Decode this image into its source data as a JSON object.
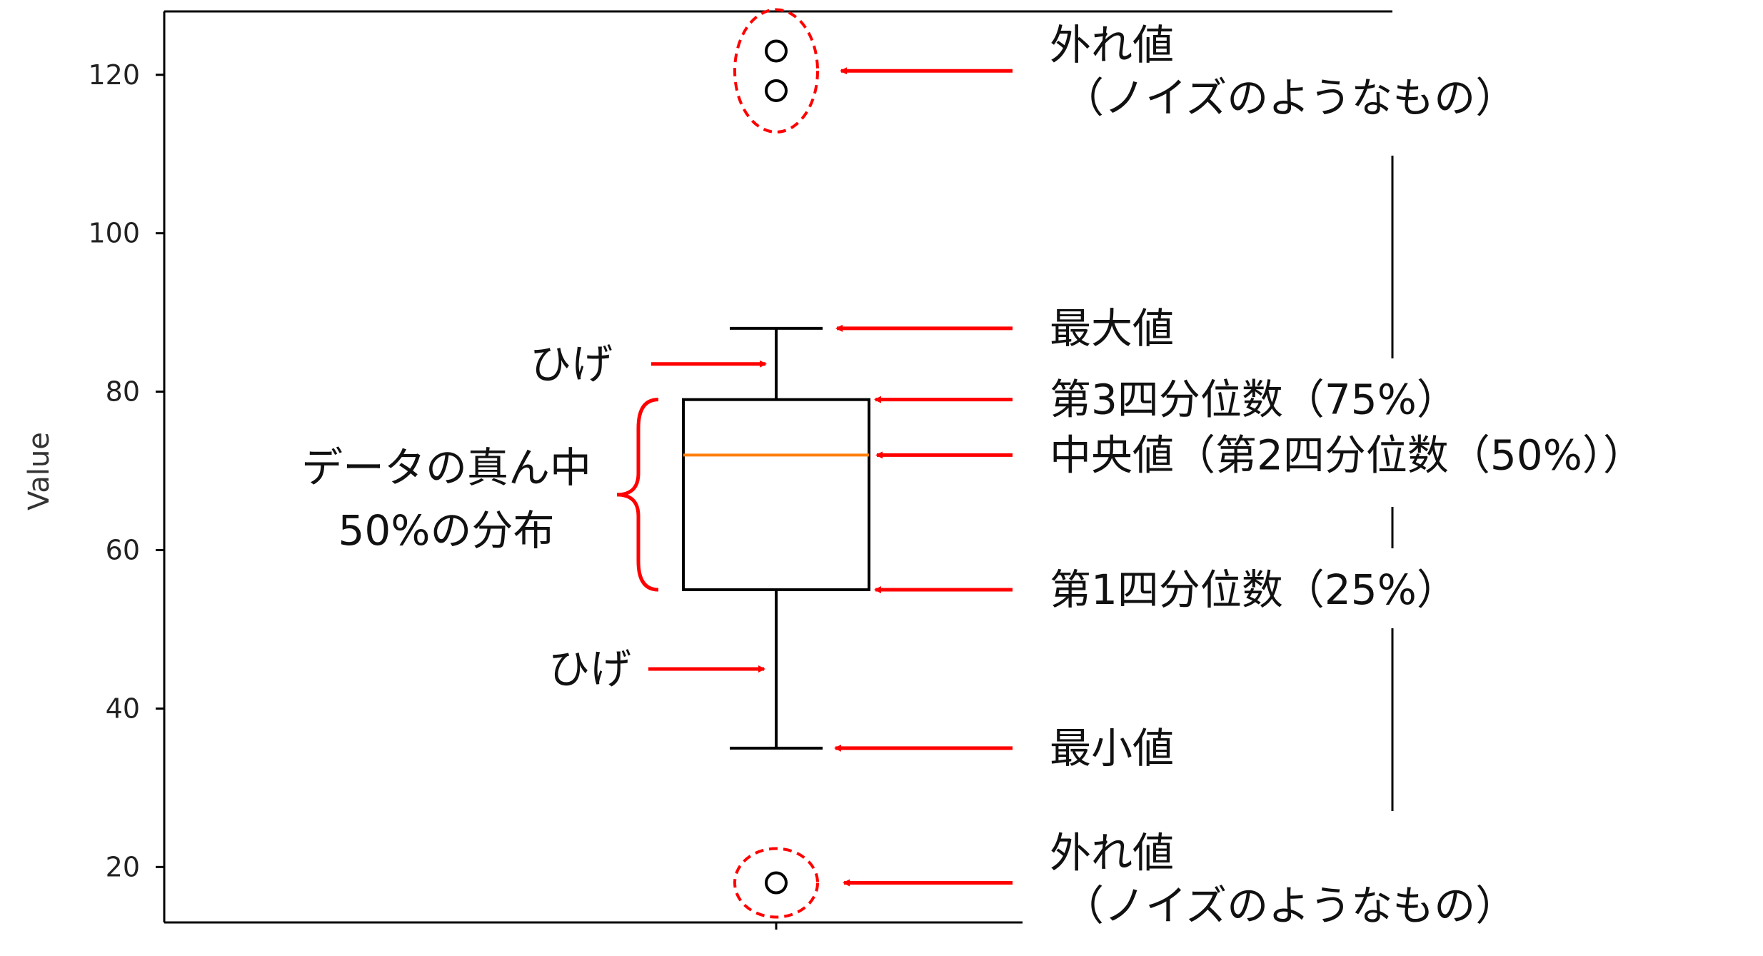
{
  "chart_data": {
    "type": "box",
    "ylabel": "Value",
    "ylim": [
      13,
      128
    ],
    "yticks": [
      20,
      40,
      60,
      80,
      100,
      120
    ],
    "grid": false,
    "box": {
      "min": 35,
      "q1": 55,
      "median": 72,
      "q3": 79,
      "max": 88,
      "outliers": [
        123,
        118,
        18
      ]
    },
    "colors": {
      "median": "#ff7f0e",
      "annotation": "#ff0000",
      "box": "#000000"
    }
  },
  "annotations": {
    "outlier": "外れ値",
    "outlier_note": "（ノイズのようなもの）",
    "max": "最大値",
    "q3": "第3四分位数（75%）",
    "median": "中央値（第2四分位数（50%））",
    "q1": "第1四分位数（25%）",
    "min": "最小値",
    "whisker": "ひげ",
    "middle_line1": "データの真ん中",
    "middle_line2": "50%の分布"
  }
}
